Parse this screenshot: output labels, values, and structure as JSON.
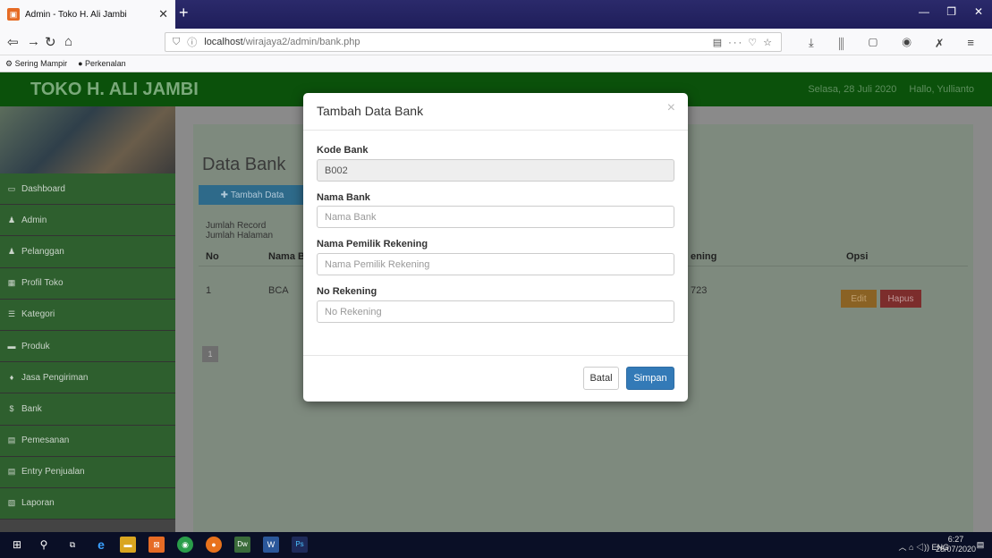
{
  "browser": {
    "tab_title": "Admin - Toko H. Ali Jambi",
    "tab_favicon": "page-icon",
    "url_host": "localhost",
    "url_path": "/wirajaya2/admin/bank.php",
    "bookmarks": [
      "Sering Mampir",
      "Perkenalan"
    ]
  },
  "header": {
    "brand": "TOKO H. ALI JAMBI",
    "date": "Selasa, 28 Juli 2020",
    "greeting": "Hallo, Yullianto"
  },
  "sidebar": {
    "items": [
      {
        "label": "Dashboard",
        "icon": "monitor-icon"
      },
      {
        "label": "Admin",
        "icon": "user-icon"
      },
      {
        "label": "Pelanggan",
        "icon": "users-icon"
      },
      {
        "label": "Profil Toko",
        "icon": "table-icon"
      },
      {
        "label": "Kategori",
        "icon": "list-icon"
      },
      {
        "label": "Produk",
        "icon": "briefcase-icon"
      },
      {
        "label": "Jasa Pengiriman",
        "icon": "map-marker-icon"
      },
      {
        "label": "Bank",
        "icon": "dollar-icon"
      },
      {
        "label": "Pemesanan",
        "icon": "card-icon"
      },
      {
        "label": "Entry Penjualan",
        "icon": "card-icon"
      },
      {
        "label": "Laporan",
        "icon": "file-icon"
      }
    ]
  },
  "main": {
    "title": "Data Bank",
    "add_button": "Tambah Data",
    "jumlah_record": "Jumlah Record",
    "jumlah_halaman": "Jumlah Halaman",
    "columns": {
      "no": "No",
      "nama": "Nama B",
      "rekening": "ening",
      "opsi": "Opsi"
    },
    "row": {
      "no": "1",
      "nama": "BCA",
      "rekening": "723"
    },
    "edit_label": "Edit",
    "hapus_label": "Hapus",
    "page_number": "1"
  },
  "modal": {
    "title": "Tambah Data Bank",
    "close": "×",
    "kode_label": "Kode Bank",
    "kode_value": "B002",
    "nama_label": "Nama Bank",
    "nama_placeholder": "Nama Bank",
    "pemilik_label": "Nama Pemilik Rekening",
    "pemilik_placeholder": "Nama Pemilik Rekening",
    "rekening_label": "No Rekening",
    "rekening_placeholder": "No Rekening",
    "cancel_label": "Batal",
    "save_label": "Simpan"
  },
  "taskbar": {
    "lang": "ENG",
    "time": "6:27",
    "date": "28/07/2020"
  }
}
